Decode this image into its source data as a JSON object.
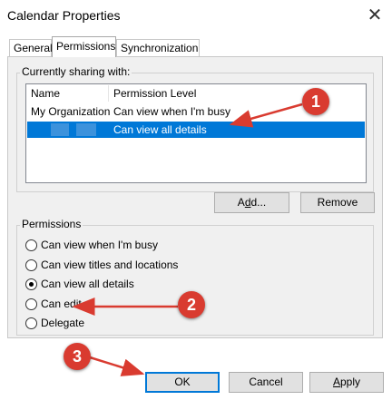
{
  "window": {
    "title": "Calendar Properties",
    "close_glyph": "✕"
  },
  "tabs": [
    {
      "label": "General",
      "active": false
    },
    {
      "label": "Permissions",
      "active": true
    },
    {
      "label": "Synchronization",
      "active": false
    }
  ],
  "sharing": {
    "group_label": "Currently sharing with:",
    "columns": [
      "Name",
      "Permission Level"
    ],
    "rows": [
      {
        "name": "My Organization",
        "level": "Can view when I'm busy",
        "selected": false
      },
      {
        "name": "",
        "level": "Can view all details",
        "selected": true
      }
    ],
    "add_label": "Add...",
    "add_underline": "d",
    "remove_label": "Remove"
  },
  "permissions": {
    "group_label": "Permissions",
    "options": [
      {
        "label": "Can view when I'm busy",
        "checked": false
      },
      {
        "label": "Can view titles and locations",
        "checked": false
      },
      {
        "label": "Can view all details",
        "checked": true
      },
      {
        "label": "Can edit",
        "checked": false
      },
      {
        "label": "Delegate",
        "checked": false
      }
    ]
  },
  "footer": {
    "ok_label": "OK",
    "cancel_label": "Cancel",
    "apply_label": "Apply"
  },
  "callouts": [
    "1",
    "2",
    "3"
  ],
  "colors": {
    "selection": "#0078d7",
    "callout": "#d93b30",
    "arrow": "#d93b30"
  }
}
